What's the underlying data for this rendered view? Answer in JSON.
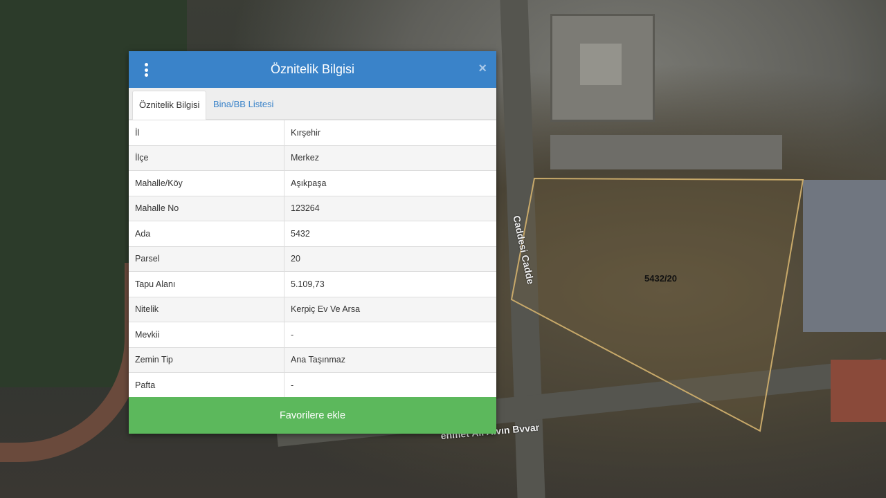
{
  "map": {
    "parcel_label": "5432/20",
    "street_vertical": "Caddesi Cadde",
    "street_horizontal": "ehmet Ali Alvın Bvvar"
  },
  "dialog": {
    "title": "Öznitelik Bilgisi",
    "close_symbol": "×",
    "tabs": [
      {
        "label": "Öznitelik Bilgisi",
        "active": true
      },
      {
        "label": "Bina/BB Listesi",
        "active": false
      }
    ],
    "rows": [
      {
        "key": "İl",
        "value": "Kırşehir"
      },
      {
        "key": "İlçe",
        "value": "Merkez"
      },
      {
        "key": "Mahalle/Köy",
        "value": "Aşıkpaşa"
      },
      {
        "key": "Mahalle No",
        "value": "123264"
      },
      {
        "key": "Ada",
        "value": "5432"
      },
      {
        "key": "Parsel",
        "value": "20"
      },
      {
        "key": "Tapu Alanı",
        "value": "5.109,73"
      },
      {
        "key": "Nitelik",
        "value": "Kerpiç Ev Ve Arsa"
      },
      {
        "key": "Mevkii",
        "value": "-"
      },
      {
        "key": "Zemin Tip",
        "value": "Ana Taşınmaz"
      },
      {
        "key": "Pafta",
        "value": "-"
      }
    ],
    "favorite_button": "Favorilere ekle"
  },
  "colors": {
    "header": "#3a83c9",
    "favorite_button": "#5cb85c",
    "parcel_outline": "#c8a96a"
  },
  "icons": {
    "menu": "vertical-dots-icon",
    "close": "close-icon"
  }
}
